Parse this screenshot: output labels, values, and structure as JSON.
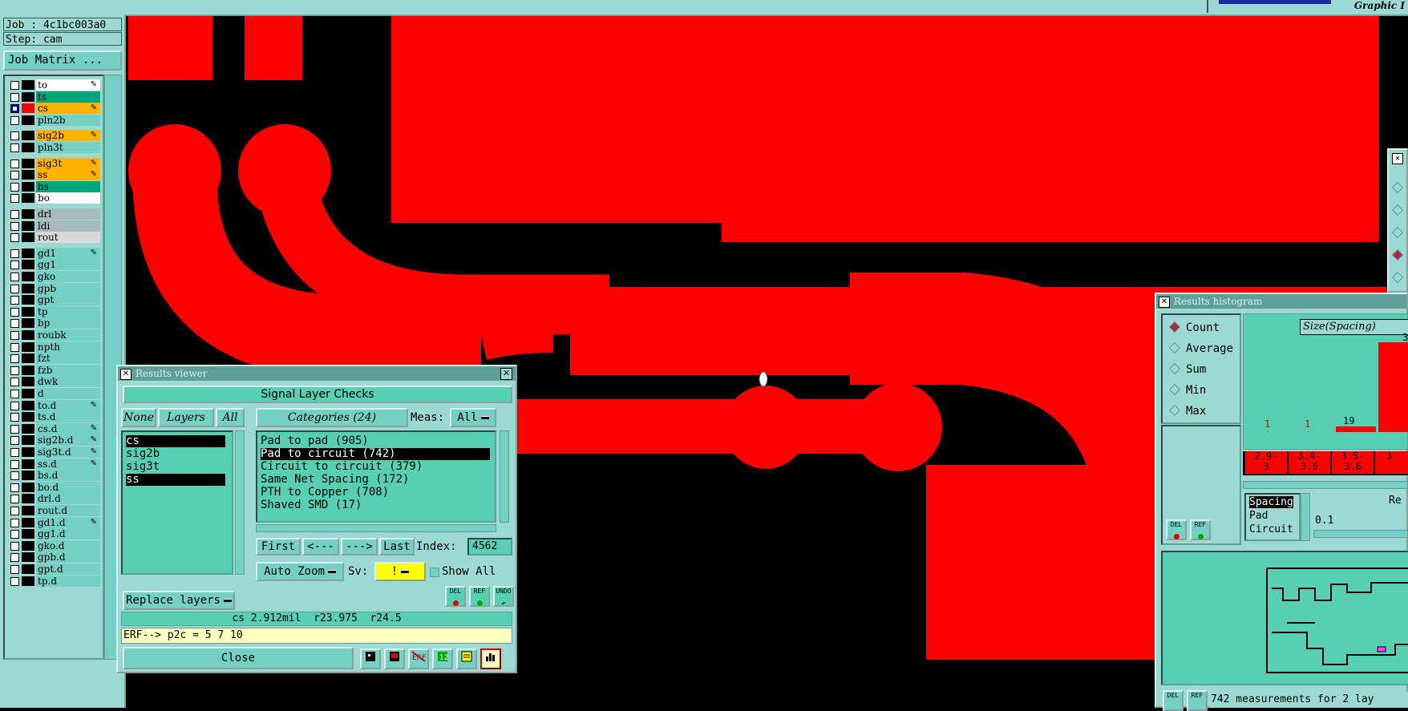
{
  "top": {
    "graphic_label": "Graphic I"
  },
  "job": {
    "job_label": "Job : 4c1bc003a0",
    "step_label": "Step: cam",
    "matrix_button": "Job Matrix ..."
  },
  "layers": [
    {
      "name": "to",
      "bg": "#ffffff",
      "swatch": "#000000",
      "checked": false,
      "edit": true
    },
    {
      "name": "ts",
      "bg": "#00a67a",
      "swatch": "#000000",
      "checked": false,
      "edit": false
    },
    {
      "name": "cs",
      "bg": "#ffb300",
      "swatch": "#ff0000",
      "checked": true,
      "edit": true
    },
    {
      "name": "pln2b",
      "bg": "#74d0c4",
      "swatch": "#000000",
      "checked": false,
      "edit": false
    },
    {
      "name": "sig2b",
      "bg": "#ffb300",
      "swatch": "#000000",
      "checked": false,
      "edit": true
    },
    {
      "name": "pln3t",
      "bg": "#74d0c4",
      "swatch": "#000000",
      "checked": false,
      "edit": false
    },
    {
      "name": "sig3t",
      "bg": "#ffb300",
      "swatch": "#000000",
      "checked": false,
      "edit": true
    },
    {
      "name": "ss",
      "bg": "#ffb300",
      "swatch": "#000000",
      "checked": false,
      "edit": true
    },
    {
      "name": "bs",
      "bg": "#00a67a",
      "swatch": "#000000",
      "checked": false,
      "edit": false
    },
    {
      "name": "bo",
      "bg": "#ffffff",
      "swatch": "#000000",
      "checked": false,
      "edit": false
    },
    {
      "name": "drl",
      "bg": "#a6b9bc",
      "swatch": "#000000",
      "checked": false,
      "edit": false
    },
    {
      "name": "ldi",
      "bg": "#a6b9bc",
      "swatch": "#000000",
      "checked": false,
      "edit": false
    },
    {
      "name": "rout",
      "bg": "#d9d9d9",
      "swatch": "#000000",
      "checked": false,
      "edit": false
    },
    {
      "name": "gd1",
      "bg": "#74d0c4",
      "swatch": "#000000",
      "checked": false,
      "edit": true
    },
    {
      "name": "gg1",
      "bg": "#74d0c4",
      "swatch": "#000000",
      "checked": false,
      "edit": false
    },
    {
      "name": "gko",
      "bg": "#74d0c4",
      "swatch": "#000000",
      "checked": false,
      "edit": false
    },
    {
      "name": "gpb",
      "bg": "#74d0c4",
      "swatch": "#000000",
      "checked": false,
      "edit": false
    },
    {
      "name": "gpt",
      "bg": "#74d0c4",
      "swatch": "#000000",
      "checked": false,
      "edit": false
    },
    {
      "name": "tp",
      "bg": "#74d0c4",
      "swatch": "#000000",
      "checked": false,
      "edit": false
    },
    {
      "name": "bp",
      "bg": "#74d0c4",
      "swatch": "#000000",
      "checked": false,
      "edit": false
    },
    {
      "name": "roubk",
      "bg": "#74d0c4",
      "swatch": "#000000",
      "checked": false,
      "edit": false
    },
    {
      "name": "npth",
      "bg": "#74d0c4",
      "swatch": "#000000",
      "checked": false,
      "edit": false
    },
    {
      "name": "fzt",
      "bg": "#74d0c4",
      "swatch": "#000000",
      "checked": false,
      "edit": false
    },
    {
      "name": "fzb",
      "bg": "#74d0c4",
      "swatch": "#000000",
      "checked": false,
      "edit": false
    },
    {
      "name": "dwk",
      "bg": "#74d0c4",
      "swatch": "#000000",
      "checked": false,
      "edit": false
    },
    {
      "name": "d",
      "bg": "#74d0c4",
      "swatch": "#000000",
      "checked": false,
      "edit": false
    },
    {
      "name": "to.d",
      "bg": "#74d0c4",
      "swatch": "#000000",
      "checked": false,
      "edit": true
    },
    {
      "name": "ts.d",
      "bg": "#74d0c4",
      "swatch": "#000000",
      "checked": false,
      "edit": false
    },
    {
      "name": "cs.d",
      "bg": "#74d0c4",
      "swatch": "#000000",
      "checked": false,
      "edit": true
    },
    {
      "name": "sig2b.d",
      "bg": "#74d0c4",
      "swatch": "#000000",
      "checked": false,
      "edit": true
    },
    {
      "name": "sig3t.d",
      "bg": "#74d0c4",
      "swatch": "#000000",
      "checked": false,
      "edit": true
    },
    {
      "name": "ss.d",
      "bg": "#74d0c4",
      "swatch": "#000000",
      "checked": false,
      "edit": true
    },
    {
      "name": "bs.d",
      "bg": "#74d0c4",
      "swatch": "#000000",
      "checked": false,
      "edit": false
    },
    {
      "name": "bo.d",
      "bg": "#74d0c4",
      "swatch": "#000000",
      "checked": false,
      "edit": false
    },
    {
      "name": "drl.d",
      "bg": "#74d0c4",
      "swatch": "#000000",
      "checked": false,
      "edit": false
    },
    {
      "name": "rout.d",
      "bg": "#74d0c4",
      "swatch": "#000000",
      "checked": false,
      "edit": false
    },
    {
      "name": "gd1.d",
      "bg": "#74d0c4",
      "swatch": "#000000",
      "checked": false,
      "edit": true
    },
    {
      "name": "gg1.d",
      "bg": "#74d0c4",
      "swatch": "#000000",
      "checked": false,
      "edit": false
    },
    {
      "name": "gko.d",
      "bg": "#74d0c4",
      "swatch": "#000000",
      "checked": false,
      "edit": false
    },
    {
      "name": "gpb.d",
      "bg": "#74d0c4",
      "swatch": "#000000",
      "checked": false,
      "edit": false
    },
    {
      "name": "gpt.d",
      "bg": "#74d0c4",
      "swatch": "#000000",
      "checked": false,
      "edit": false
    },
    {
      "name": "tp.d",
      "bg": "#74d0c4",
      "swatch": "#000000",
      "checked": false,
      "edit": false
    }
  ],
  "results_viewer": {
    "title": "Results viewer",
    "header": "Signal Layer Checks",
    "none_btn": "None",
    "layers_btn": "Layers",
    "all_btn": "All",
    "layer_items": [
      {
        "label": "cs",
        "selected": true
      },
      {
        "label": "sig2b",
        "selected": false
      },
      {
        "label": "sig3t",
        "selected": false
      },
      {
        "label": "ss",
        "selected": true
      }
    ],
    "categories_btn": "Categories (24)",
    "meas_label": "Meas:",
    "meas_value": "All",
    "categories": [
      {
        "label": "Pad to pad (905)",
        "selected": false
      },
      {
        "label": "Pad to circuit (742)",
        "selected": true
      },
      {
        "label": "Circuit to circuit (379)",
        "selected": false
      },
      {
        "label": "Same Net Spacing (172)",
        "selected": false
      },
      {
        "label": "PTH to Copper (708)",
        "selected": false
      },
      {
        "label": "Shaved SMD (17)",
        "selected": false
      }
    ],
    "first_btn": "First",
    "prev_btn": "<---",
    "next_btn": "--->",
    "last_btn": "Last",
    "index_label": "Index:",
    "index_value": "4562",
    "replace_btn": "Replace layers",
    "autozoom_btn": "Auto Zoom",
    "sv_label": "Sv:",
    "sv_value": "!",
    "showall_label": "Show All",
    "del_label": "DEL",
    "ref_label": "REF",
    "undo_label": "UNDO",
    "status_text": "cs 2.912mil  r23.975  r24.5",
    "erf_text": "ERF--> p2c = 5 7 10",
    "close_btn": "Close"
  },
  "histogram": {
    "title": "Results histogram",
    "radios": [
      {
        "label": "Count",
        "on": true
      },
      {
        "label": "Average",
        "on": false
      },
      {
        "label": "Sum",
        "on": false
      },
      {
        "label": "Min",
        "on": false
      },
      {
        "label": "Max",
        "on": false
      }
    ],
    "size_label": "Size(Spacing)",
    "bar_top_label": "3",
    "bars": [
      {
        "range": "2.9-\n3",
        "count": 1
      },
      {
        "range": "3.4-\n3.5",
        "count": 1
      },
      {
        "range": "3.5-\n3.6",
        "count": 19
      },
      {
        "range": "3.",
        "count": 3
      }
    ],
    "count_labels": [
      "1",
      "1",
      "19"
    ],
    "bin_labels": [
      "2.9-",
      "3",
      "3.4-",
      "3.5",
      "3.5-",
      "3.6",
      "3."
    ],
    "list_items": [
      {
        "label": "Spacing",
        "selected": true
      },
      {
        "label": "Pad",
        "selected": false
      },
      {
        "label": "Circuit",
        "selected": false
      }
    ],
    "re_label": "Re",
    "value_label": "0.1",
    "del_label": "DEL",
    "ref_label": "REF",
    "footer_text": "742 measurements for 2 lay"
  }
}
